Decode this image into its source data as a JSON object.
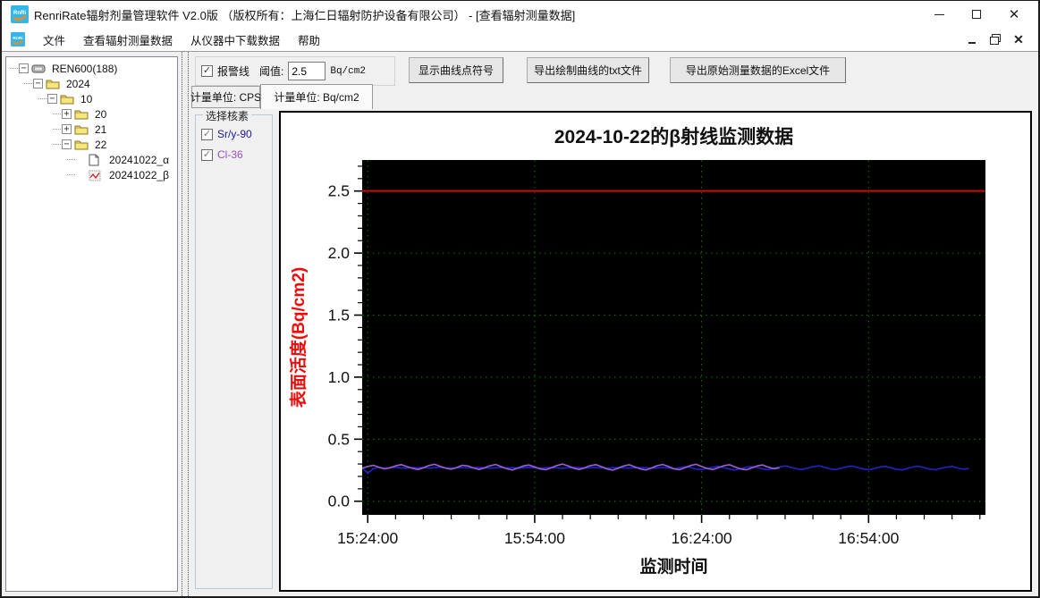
{
  "window": {
    "title": "RenriRate辐射剂量管理软件 V2.0版 （版权所有：上海仁日辐射防护设备有限公司）  - [查看辐射测量数据]"
  },
  "menu": {
    "items": [
      "文件",
      "查看辐射测量数据",
      "从仪器中下载数据",
      "帮助"
    ]
  },
  "tree": {
    "root": {
      "label": "REN600(188)",
      "icon": "device-icon",
      "expander": "minus",
      "children": [
        {
          "label": "2024",
          "icon": "folder-icon",
          "expander": "minus",
          "children": [
            {
              "label": "10",
              "icon": "folder-icon",
              "expander": "minus",
              "children": [
                {
                  "label": "20",
                  "icon": "folder-icon",
                  "expander": "plus"
                },
                {
                  "label": "21",
                  "icon": "folder-icon",
                  "expander": "plus"
                },
                {
                  "label": "22",
                  "icon": "folder-icon",
                  "expander": "minus",
                  "children": [
                    {
                      "label": "20241022_α",
                      "icon": "document-icon"
                    },
                    {
                      "label": "20241022_β",
                      "icon": "chart-file-icon"
                    }
                  ]
                }
              ]
            }
          ]
        }
      ]
    }
  },
  "toolbar": {
    "alarm_checkbox_label": "报警线",
    "alarm_checked": true,
    "threshold_label": "阈值:",
    "threshold_value": "2.5",
    "threshold_unit": "Bq/cm2",
    "buttons": [
      "显示曲线点符号",
      "导出绘制曲线的txt文件",
      "导出原始测量数据的Excel文件"
    ]
  },
  "tabs": [
    {
      "label": "计量单位: CPS",
      "active": false
    },
    {
      "label": "计量单位: Bq/cm2",
      "active": true
    }
  ],
  "nuclide_panel": {
    "title": "选择核素",
    "items": [
      {
        "label": "Sr/y-90",
        "checked": true,
        "color": "#1a1a99"
      },
      {
        "label": "Cl-36",
        "checked": true,
        "color": "#9c4fc9"
      }
    ]
  },
  "chart_data": {
    "type": "line",
    "title": "2024-10-22的β射线监测数据",
    "xlabel": "监测时间",
    "ylabel": "表面活度(Bq/cm2)",
    "plot_bg": "#000000",
    "grid_color": "#0c7a0c",
    "ylim": [
      -0.11,
      2.75
    ],
    "xlim_minutes": [
      0,
      112
    ],
    "y_major_step": 0.5,
    "y_minor_step": 0.1,
    "y_tick_labels": [
      "0.0",
      "0.5",
      "1.0",
      "1.5",
      "2.0",
      "2.5"
    ],
    "x_major_ticks": [
      {
        "t": 1,
        "label": "15:24:00"
      },
      {
        "t": 31,
        "label": "15:54:00"
      },
      {
        "t": 61,
        "label": "16:24:00"
      },
      {
        "t": 91,
        "label": "16:54:00"
      }
    ],
    "x_minor_step": 5,
    "alarm_line": {
      "value": 2.5,
      "color": "#dd0000"
    },
    "series": [
      {
        "name": "Sr/y-90",
        "color": "#2323cc",
        "t_start": 0,
        "t_step": 1,
        "values": [
          0.27,
          0.225,
          0.262,
          0.272,
          0.268,
          0.27,
          0.273,
          0.269,
          0.266,
          0.271,
          0.269,
          0.272,
          0.267,
          0.27,
          0.274,
          0.27,
          0.266,
          0.269,
          0.272,
          0.268,
          0.27,
          0.273,
          0.269,
          0.266,
          0.27,
          0.272,
          0.268,
          0.271,
          0.267,
          0.27,
          0.273,
          0.268,
          0.266,
          0.27,
          0.272,
          0.269,
          0.266,
          0.27,
          0.273,
          0.27,
          0.267,
          0.27,
          0.272,
          0.268,
          0.266,
          0.27,
          0.272,
          0.269,
          0.267,
          0.27,
          0.272,
          0.269,
          0.266,
          0.269,
          0.272,
          0.268,
          0.262,
          0.27,
          0.278,
          0.272,
          0.26,
          0.255,
          0.265,
          0.275,
          0.282,
          0.27,
          0.258,
          0.252,
          0.262,
          0.274,
          0.28,
          0.272,
          0.26,
          0.254,
          0.266,
          0.276,
          0.284,
          0.274,
          0.262,
          0.256,
          0.266,
          0.278,
          0.285,
          0.275,
          0.262,
          0.255,
          0.265,
          0.277,
          0.283,
          0.272,
          0.26,
          0.253,
          0.263,
          0.275,
          0.281,
          0.27,
          0.258,
          0.252,
          0.264,
          0.276,
          0.282,
          0.271,
          0.259,
          0.254,
          0.265,
          0.275,
          0.28,
          0.268,
          0.258,
          0.264
        ]
      },
      {
        "name": "Cl-36",
        "color": "#9a62d0",
        "t_start": 0,
        "t_step": 1,
        "values": [
          0.265,
          0.28,
          0.29,
          0.275,
          0.26,
          0.27,
          0.285,
          0.295,
          0.28,
          0.265,
          0.255,
          0.27,
          0.288,
          0.298,
          0.282,
          0.266,
          0.258,
          0.272,
          0.29,
          0.284,
          0.268,
          0.256,
          0.27,
          0.286,
          0.296,
          0.278,
          0.262,
          0.252,
          0.268,
          0.285,
          0.292,
          0.276,
          0.26,
          0.254,
          0.27,
          0.288,
          0.3,
          0.284,
          0.266,
          0.256,
          0.27,
          0.287,
          0.295,
          0.278,
          0.26,
          0.25,
          0.266,
          0.284,
          0.294,
          0.276,
          0.26,
          0.252,
          0.268,
          0.286,
          0.296,
          0.28,
          0.262,
          0.254,
          0.27,
          0.288,
          0.298,
          0.28,
          0.264,
          0.255,
          0.27,
          0.286,
          0.294,
          0.276,
          0.26,
          0.253,
          0.268,
          0.285,
          0.292,
          0.274,
          0.262,
          0.27
        ]
      }
    ]
  }
}
